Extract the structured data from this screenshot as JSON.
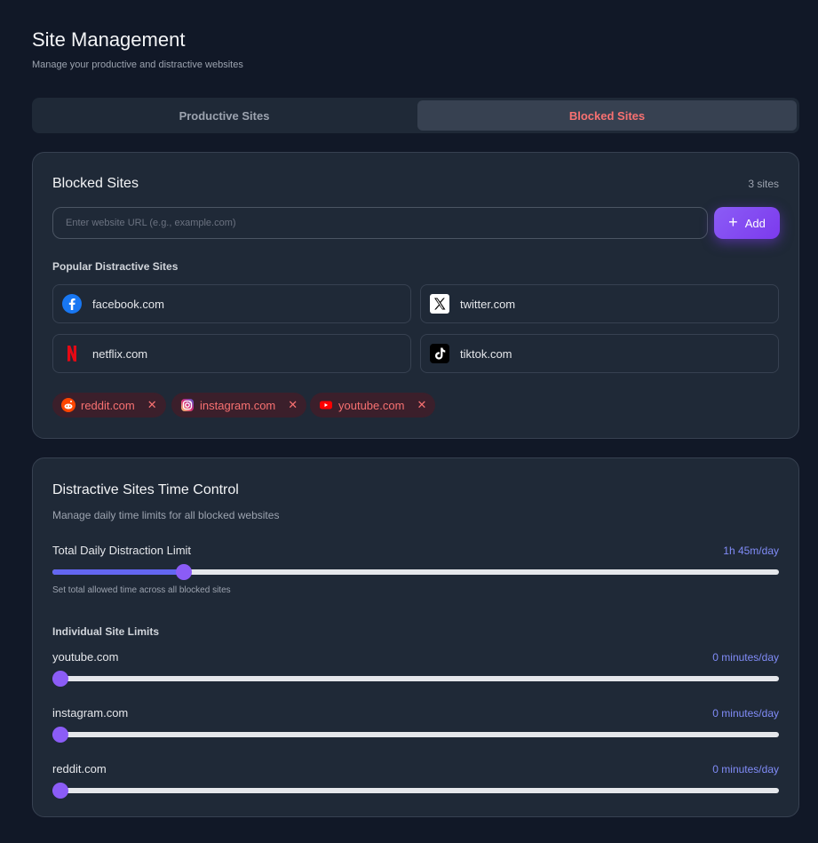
{
  "header": {
    "title": "Site Management",
    "subtitle": "Manage your productive and distractive websites"
  },
  "tabs": [
    {
      "label": "Productive Sites",
      "active": false
    },
    {
      "label": "Blocked Sites",
      "active": true
    }
  ],
  "blocked": {
    "title": "Blocked Sites",
    "count_label": "3 sites",
    "input_placeholder": "Enter website URL (e.g., example.com)",
    "input_value": "",
    "add_label": "Add",
    "popular_label": "Popular Distractive Sites",
    "popular": [
      {
        "name": "facebook.com",
        "icon": "facebook-icon"
      },
      {
        "name": "twitter.com",
        "icon": "x-icon"
      },
      {
        "name": "netflix.com",
        "icon": "netflix-icon"
      },
      {
        "name": "tiktok.com",
        "icon": "tiktok-icon"
      }
    ],
    "chips": [
      {
        "name": "reddit.com",
        "icon": "reddit-icon",
        "close": "✕"
      },
      {
        "name": "instagram.com",
        "icon": "instagram-icon",
        "close": "✕"
      },
      {
        "name": "youtube.com",
        "icon": "youtube-icon",
        "close": "✕"
      }
    ]
  },
  "time_control": {
    "title": "Distractive Sites Time Control",
    "description": "Manage daily time limits for all blocked websites",
    "total": {
      "label": "Total Daily Distraction Limit",
      "value": "1h 45m/day",
      "fraction": 0.174,
      "helper": "Set total allowed time across all blocked sites"
    },
    "individual_label": "Individual Site Limits",
    "sites": [
      {
        "name": "youtube.com",
        "value": "0 minutes/day",
        "fraction": 0
      },
      {
        "name": "instagram.com",
        "value": "0 minutes/day",
        "fraction": 0
      },
      {
        "name": "reddit.com",
        "value": "0 minutes/day",
        "fraction": 0
      }
    ]
  },
  "colors": {
    "accent": "#8b5cf6",
    "danger": "#f87171",
    "background": "#111827",
    "card": "#1f2937"
  }
}
